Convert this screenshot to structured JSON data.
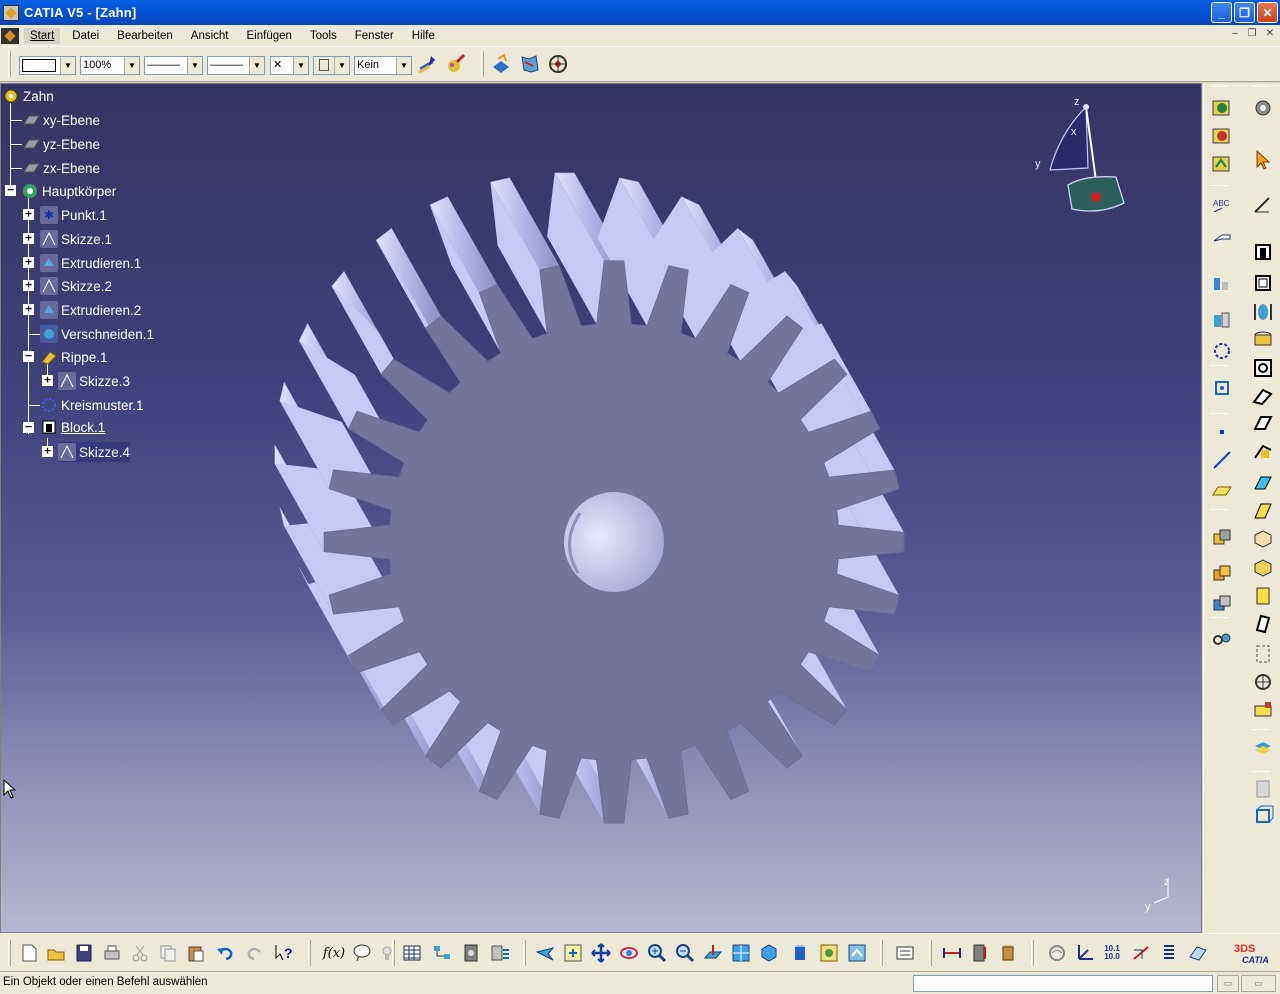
{
  "window": {
    "title": "CATIA V5 - [Zahn]",
    "minimize_label": "_",
    "maximize_label": "❐",
    "close_label": "✕"
  },
  "menu": {
    "items": [
      "Start",
      "Datei",
      "Bearbeiten",
      "Ansicht",
      "Einfügen",
      "Tools",
      "Fenster",
      "Hilfe"
    ],
    "mdi_controls": [
      "–",
      "❐",
      "✕"
    ]
  },
  "toolbar_top": {
    "color_value": "",
    "transparency_value": "100%",
    "linetype_value": "———",
    "linewidth_value": "———",
    "point_symbol_value": "✕",
    "layer_value": "",
    "rendering_value": "Kein"
  },
  "spec_tree": {
    "root": "Zahn",
    "planes": [
      "xy-Ebene",
      "yz-Ebene",
      "zx-Ebene"
    ],
    "body": "Hauptkörper",
    "features": [
      "Punkt.1",
      "Skizze.1",
      "Extrudieren.1",
      "Skizze.2",
      "Extrudieren.2",
      "Verschneiden.1",
      "Rippe.1",
      "Skizze.3",
      "Kreismuster.1",
      "Block.1",
      "Skizze.4"
    ]
  },
  "compass": {
    "axis_x": "x",
    "axis_y": "y",
    "axis_z": "z"
  },
  "mini_axes": {
    "axis_y": "y",
    "axis_z": "z"
  },
  "bottom_toolbar": {
    "formula_label": "f(x)",
    "decimal_label": "10.1\n10.0"
  },
  "statusbar": {
    "message": "Ein Objekt oder einen Befehl auswählen",
    "command_value": ""
  },
  "colors": {
    "title_bar": "#0553d6",
    "viewport_top": "#363461",
    "viewport_bottom": "#b7b7d3",
    "gear_face": "#74749c",
    "gear_teeth": "#b9b9ea",
    "hub": "#c8c8f2"
  },
  "branding": {
    "logo": "3DS CATIA"
  }
}
